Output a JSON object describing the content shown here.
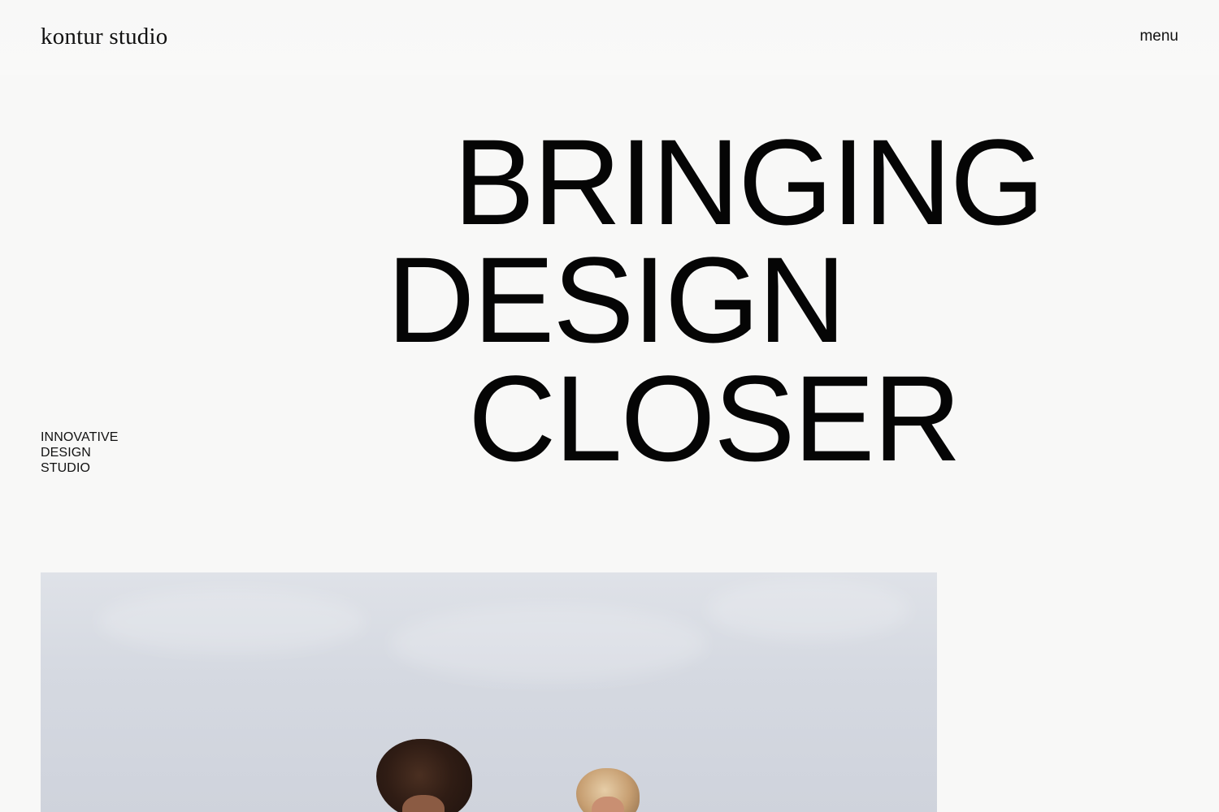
{
  "header": {
    "logo_text": "kontur studio",
    "menu_label": "menu"
  },
  "hero": {
    "lines": [
      "BRINGING",
      "DESIGN",
      "CLOSER"
    ],
    "tagline": [
      "INNOVATIVE",
      "DESIGN",
      "STUDIO"
    ]
  },
  "colors": {
    "background": "#f8f8f7",
    "text": "#050505",
    "image_sky": "#d5d9e1"
  },
  "icons": {}
}
